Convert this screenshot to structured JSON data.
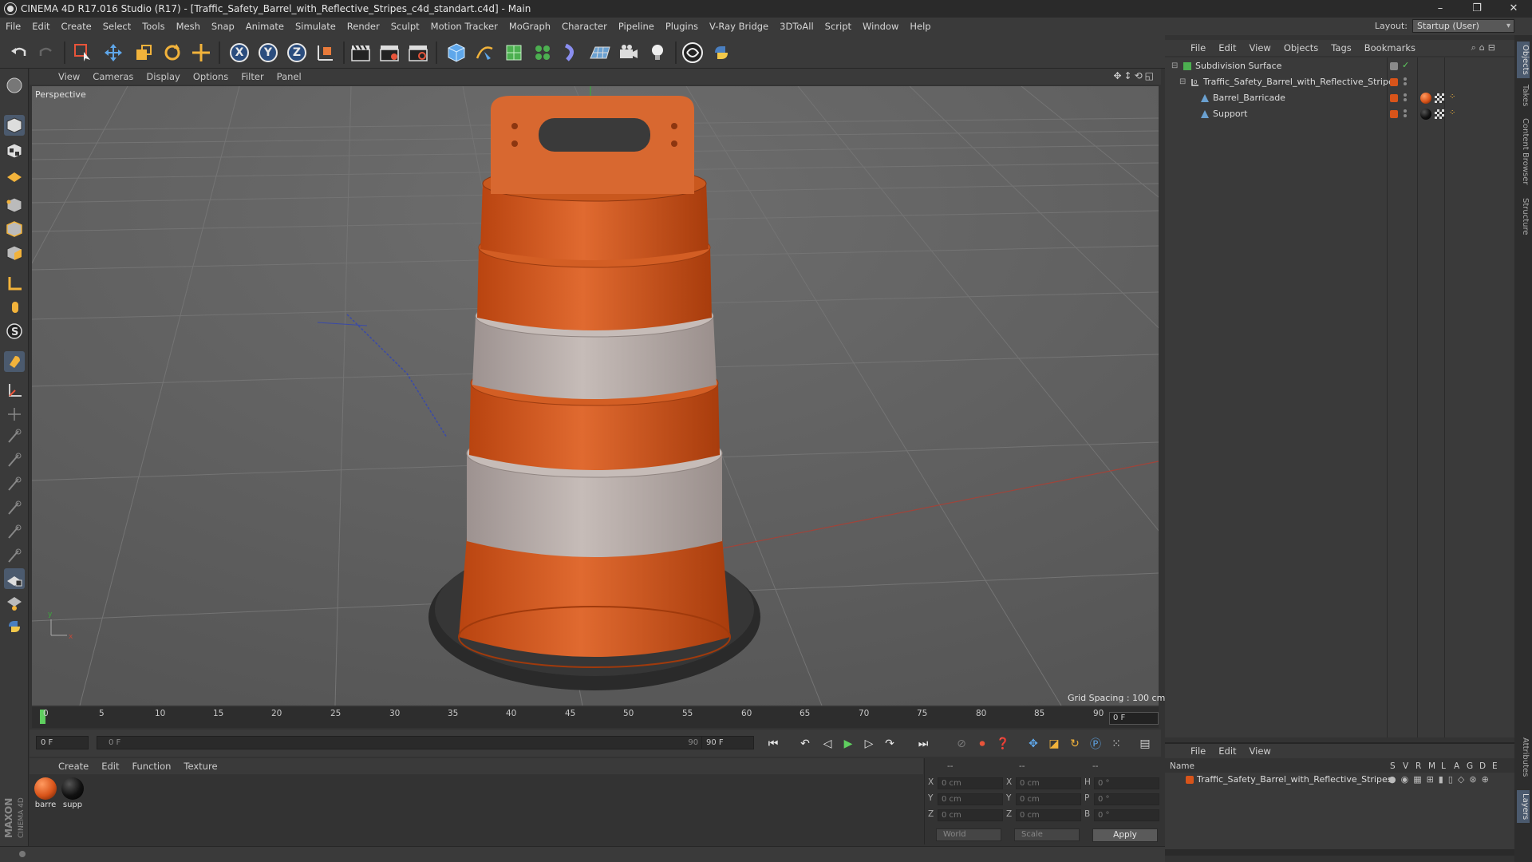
{
  "window": {
    "title": "CINEMA 4D R17.016 Studio (R17) - [Traffic_Safety_Barrel_with_Reflective_Stripes_c4d_standart.c4d] - Main",
    "controls": [
      "–",
      "❐",
      "✕"
    ]
  },
  "menubar": {
    "items": [
      "File",
      "Edit",
      "Create",
      "Select",
      "Tools",
      "Mesh",
      "Snap",
      "Animate",
      "Simulate",
      "Render",
      "Sculpt",
      "Motion Tracker",
      "MoGraph",
      "Character",
      "Pipeline",
      "Plugins",
      "V-Ray Bridge",
      "3DToAll",
      "Script",
      "Window",
      "Help"
    ],
    "layout_label": "Layout:",
    "layout_value": "Startup (User)"
  },
  "toolbar": {
    "axis_x": "X",
    "axis_y": "Y",
    "axis_z": "Z"
  },
  "viewport": {
    "menu": [
      "View",
      "Cameras",
      "Display",
      "Options",
      "Filter",
      "Panel"
    ],
    "label": "Perspective",
    "grid_spacing": "Grid Spacing : 100 cm"
  },
  "timeline": {
    "ticks": [
      "0",
      "5",
      "10",
      "15",
      "20",
      "25",
      "30",
      "35",
      "40",
      "45",
      "50",
      "55",
      "60",
      "65",
      "70",
      "75",
      "80",
      "85",
      "90"
    ],
    "frame_display": "0 F"
  },
  "playback": {
    "start_field": "0 F",
    "range_start": "0 F",
    "range_end": "90 F",
    "end_field": "90 F"
  },
  "materials": {
    "menu": [
      "Create",
      "Edit",
      "Function",
      "Texture"
    ],
    "items": [
      {
        "label": "barre",
        "color": "#d8541a"
      },
      {
        "label": "supp",
        "color": "#111111"
      }
    ]
  },
  "coordinates": {
    "header": [
      "--",
      "--",
      "--"
    ],
    "rows": [
      {
        "a": "X",
        "av": "0 cm",
        "b": "X",
        "bv": "0 cm",
        "c": "H",
        "cv": "0 °"
      },
      {
        "a": "Y",
        "av": "0 cm",
        "b": "Y",
        "bv": "0 cm",
        "c": "P",
        "cv": "0 °"
      },
      {
        "a": "Z",
        "av": "0 cm",
        "b": "Z",
        "bv": "0 cm",
        "c": "B",
        "cv": "0 °"
      }
    ],
    "world": "World",
    "scale": "Scale",
    "apply": "Apply"
  },
  "object_manager": {
    "menu": [
      "File",
      "Edit",
      "View",
      "Objects",
      "Tags",
      "Bookmarks"
    ],
    "objects": [
      {
        "name": "Subdivision Surface",
        "indent": 0
      },
      {
        "name": "Traffic_Safety_Barrel_with_Reflective_Stripes",
        "indent": 1
      },
      {
        "name": "Barrel_Barricade",
        "indent": 2
      },
      {
        "name": "Support",
        "indent": 2
      }
    ]
  },
  "layer_manager": {
    "menu": [
      "File",
      "Edit",
      "View"
    ],
    "header_name": "Name",
    "header_cols": [
      "S",
      "V",
      "R",
      "M",
      "L",
      "A",
      "G",
      "D",
      "E"
    ],
    "rows": [
      "Traffic_Safety_Barrel_with_Reflective_Stripes"
    ]
  },
  "right_tabs": [
    "Objects",
    "Takes",
    "Content Browser",
    "Structure",
    "Attributes",
    "Layers"
  ],
  "branding": {
    "maxon": "MAXON",
    "product": "CINEMA 4D"
  },
  "colors": {
    "accent_orange": "#d8541a",
    "barrel_white": "#b5aaa6",
    "viewport_bg": "#5f5f5f"
  }
}
